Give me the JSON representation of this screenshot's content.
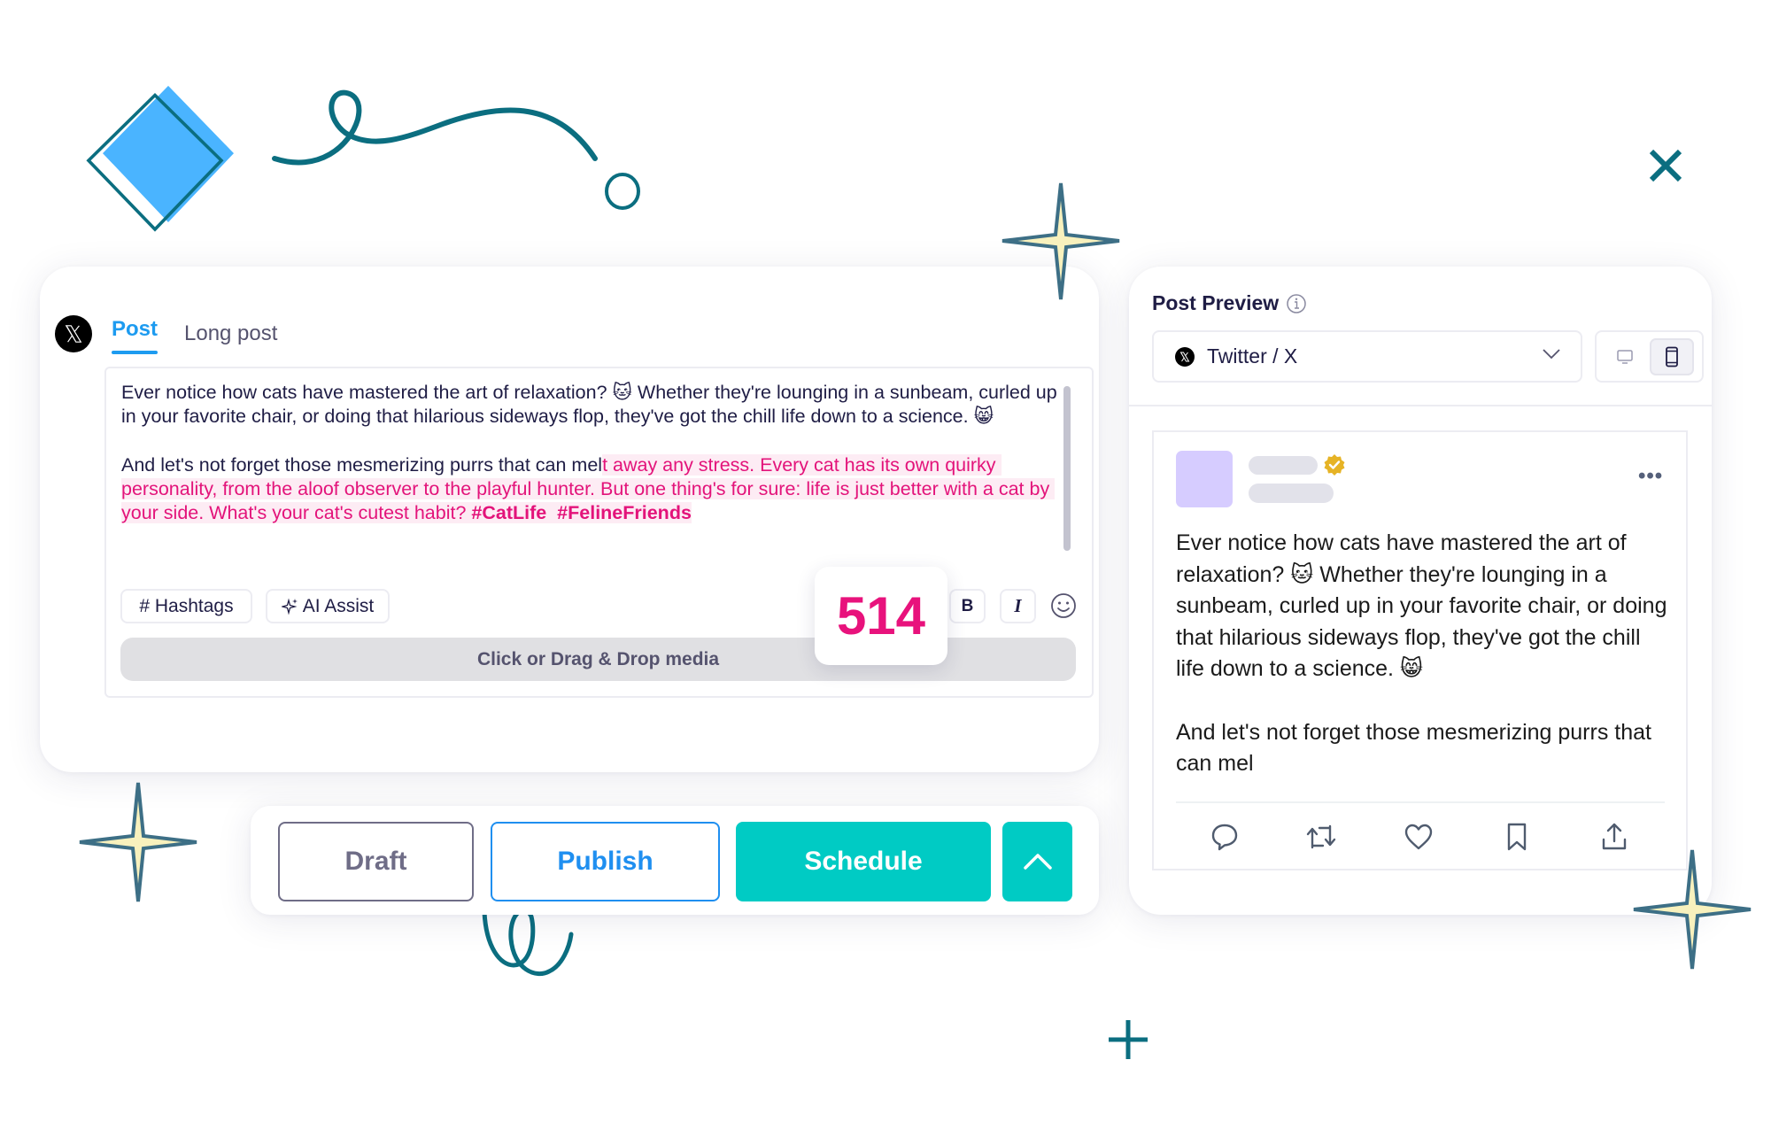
{
  "editor": {
    "platform_icon": "x-logo-icon",
    "tabs": [
      {
        "label": "Post",
        "active": true
      },
      {
        "label": "Long post",
        "active": false
      }
    ],
    "text_normal": "Ever notice how cats have mastered the art of relaxation? 🐱 Whether they're lounging in a sunbeam, curled up in your favorite chair, or doing that hilarious sideways flop, they've got the chill life down to a science. 😸\n\nAnd let's not forget those mesmerizing purrs that can mel",
    "text_overflow": "t away any stress. Every cat has its own quirky personality, from the aloof observer to the playful hunter. But one thing's for sure: life is just better with a cat by your side. What's your cat's cutest habit? ",
    "hashtag_1": "#CatLife",
    "hashtag_2": "#FelineFriends",
    "hashtags_label": "# Hashtags",
    "ai_assist_label": "AI Assist",
    "bold_label": "B",
    "italic_label": "I",
    "char_count": "514",
    "drop_media_label": "Click or Drag & Drop media"
  },
  "actions": {
    "draft_label": "Draft",
    "publish_label": "Publish",
    "schedule_label": "Schedule",
    "more_icon": "chevron-up-icon"
  },
  "preview": {
    "title": "Post Preview",
    "platform_selected": "Twitter / X",
    "device_options": [
      "desktop",
      "mobile"
    ],
    "device_selected": "mobile",
    "tweet_text": "Ever notice how cats have mastered the art of relaxation? 🐱 Whether they're lounging in a sunbeam, curled up in your favorite chair, or doing that hilarious sideways flop, they've got the chill life down to a science. 😸\n\nAnd let's not forget those mesmerizing purrs that can mel",
    "more_label": "•••",
    "tweet_actions": [
      "reply",
      "repost",
      "like",
      "bookmark",
      "share"
    ]
  },
  "colors": {
    "accent_blue": "#1d9bf0",
    "publish_blue": "#1f8ff0",
    "schedule_teal": "#00cbc4",
    "overflow_pink": "#e3137a",
    "counter_pink": "#e8127c",
    "decor_teal": "#0b6e80",
    "star_fill": "#f8f1bd"
  }
}
